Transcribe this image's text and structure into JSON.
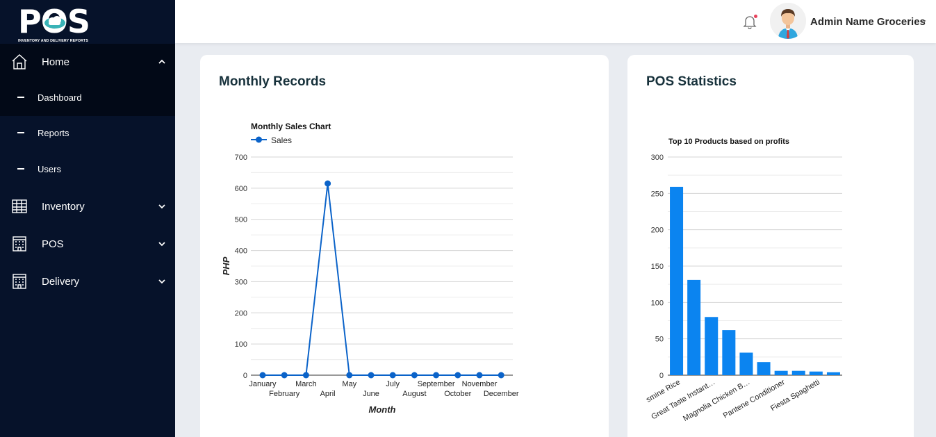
{
  "app": {
    "logo_text": "POS",
    "logo_subtitle": "INVENTORY AND DELIVERY REPORTS"
  },
  "sidebar": {
    "home": {
      "label": "Home",
      "icon": "home-icon",
      "expanded": true
    },
    "home_items": [
      {
        "label": "Dashboard",
        "active": true
      },
      {
        "label": "Reports"
      },
      {
        "label": "Users"
      }
    ],
    "inventory": {
      "label": "Inventory",
      "icon": "grid-table-icon"
    },
    "pos": {
      "label": "POS",
      "icon": "building-icon"
    },
    "delivery": {
      "label": "Delivery",
      "icon": "building-icon"
    }
  },
  "header": {
    "user_name": "Admin Name Groceries",
    "notification_dot_color": "#e8415b"
  },
  "cards": {
    "monthly": {
      "title": "Monthly Records"
    },
    "pos": {
      "title": "POS Statistics"
    }
  },
  "chart_data": [
    {
      "type": "line",
      "title": "Monthly Sales Chart",
      "xlabel": "Month",
      "ylabel": "PHP",
      "ylim": [
        0,
        700
      ],
      "yticks": [
        "0",
        "100",
        "200",
        "300",
        "400",
        "500",
        "600",
        "700"
      ],
      "legend_position": "top-left",
      "color": "#0b63c9",
      "categories": [
        "January",
        "February",
        "March",
        "April",
        "May",
        "June",
        "July",
        "August",
        "September",
        "October",
        "November",
        "December"
      ],
      "series": [
        {
          "name": "Sales",
          "values": [
            0,
            0,
            0,
            615,
            0,
            0,
            0,
            0,
            0,
            0,
            0,
            0
          ]
        }
      ]
    },
    {
      "type": "bar",
      "title": "Top 10 Products based on profits",
      "ylim": [
        0,
        300
      ],
      "yticks": [
        "0",
        "50",
        "100",
        "150",
        "200",
        "250",
        "300"
      ],
      "color": "#0b84f0",
      "categories": [
        "Jasmine Rice",
        "",
        "Great Taste Instant…",
        "",
        "Magnolia Chicken B…",
        "",
        "Pantene Conditioner",
        "",
        "Fiesta Spaghetti",
        ""
      ],
      "visible_tick_labels": [
        "smine Rice",
        "Great Taste Instant…",
        "Magnolia Chicken B…",
        "Pantene Conditioner",
        "Fiesta Spaghetti"
      ],
      "values": [
        259,
        131,
        80,
        62,
        31,
        18,
        6,
        6,
        5,
        4
      ]
    }
  ]
}
